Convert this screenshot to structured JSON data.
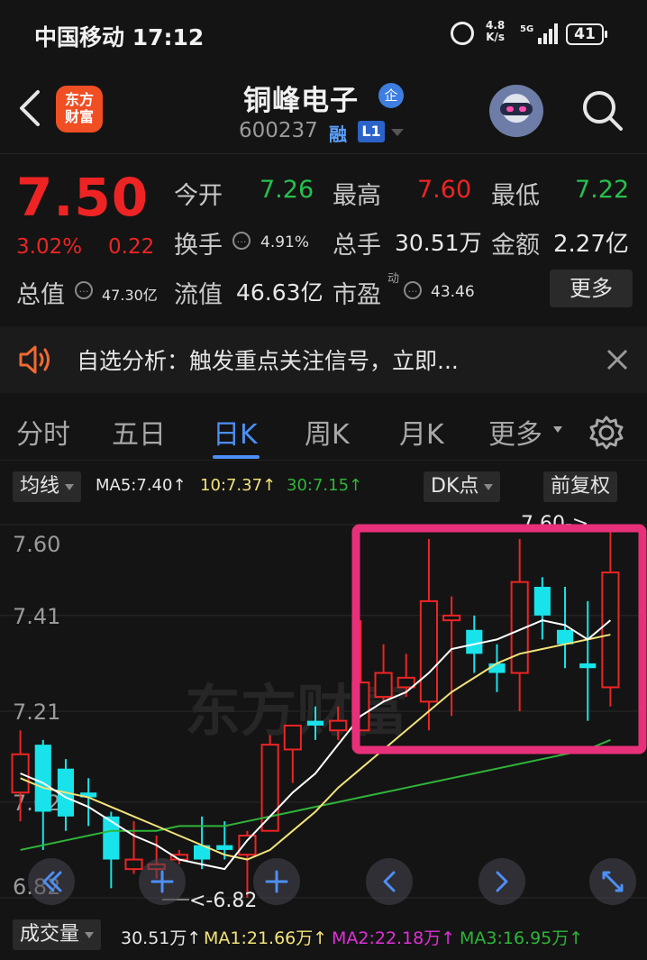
{
  "status": {
    "carrier": "中国移动 17:12",
    "speed_top": "4.8",
    "speed_bottom": "K/s",
    "network": "5G",
    "battery": "41"
  },
  "header": {
    "logo": [
      "东方",
      "财富"
    ],
    "name": "铜峰电子",
    "badge": "企",
    "code": "600237",
    "margin_tag": "融",
    "level": "L1"
  },
  "quote": {
    "price": "7.50",
    "change_pct": "3.02%",
    "change": "0.22",
    "open_label": "今开",
    "open": "7.26",
    "high_label": "最高",
    "high": "7.60",
    "low_label": "最低",
    "low": "7.22",
    "turnover_label": "换手",
    "turnover": "4.91%",
    "volume_label": "总手",
    "volume": "30.51万",
    "amount_label": "金额",
    "amount": "2.27亿",
    "mktcap_label": "总值",
    "mktcap": "47.30亿",
    "float_label": "流值",
    "float": "46.63亿",
    "pe_label": "市盈",
    "pe_sup": "动",
    "pe": "43.46",
    "more": "更多"
  },
  "alert": {
    "text": "自选分析：触发重点关注信号，立即..."
  },
  "tabs": {
    "items": [
      "分时",
      "五日",
      "日K",
      "周K",
      "月K",
      "更多"
    ],
    "active": "日K"
  },
  "ma": {
    "selector": "均线",
    "ma5": "MA5:7.40↑",
    "ma10": "10:7.37↑",
    "ma30": "30:7.15↑",
    "dk": "DK点",
    "adjust": "前复权"
  },
  "colors": {
    "up": "#ee2424",
    "down": "#19e3ea",
    "ma5": "#ffffff",
    "ma10": "#f3e37a",
    "ma30": "#2fb43a",
    "highlight": "#e8307a",
    "accent": "#4d8ff5"
  },
  "chart_data": {
    "type": "candlestick",
    "y_ticks": [
      "7.60",
      "7.41",
      "7.21",
      "7.02",
      "6.82"
    ],
    "ylim": [
      6.82,
      7.6
    ],
    "watermark": "东方财富",
    "high_marker": "7.60->",
    "low_marker": "<-6.82",
    "candles": [
      {
        "o": 7.04,
        "c": 7.12,
        "h": 7.17,
        "l": 6.98
      },
      {
        "o": 7.14,
        "c": 7.0,
        "h": 7.15,
        "l": 6.92
      },
      {
        "o": 7.09,
        "c": 6.99,
        "h": 7.11,
        "l": 6.96
      },
      {
        "o": 7.04,
        "c": 7.03,
        "h": 7.07,
        "l": 6.97
      },
      {
        "o": 6.99,
        "c": 6.9,
        "h": 7.0,
        "l": 6.84
      },
      {
        "o": 6.88,
        "c": 6.9,
        "h": 6.98,
        "l": 6.87
      },
      {
        "o": 6.88,
        "c": 6.89,
        "h": 6.95,
        "l": 6.86
      },
      {
        "o": 6.9,
        "c": 6.91,
        "h": 6.92,
        "l": 6.89
      },
      {
        "o": 6.93,
        "c": 6.9,
        "h": 6.99,
        "l": 6.88
      },
      {
        "o": 6.93,
        "c": 6.92,
        "h": 6.98,
        "l": 6.9
      },
      {
        "o": 6.91,
        "c": 6.95,
        "h": 6.96,
        "l": 6.82
      },
      {
        "o": 6.96,
        "c": 7.14,
        "h": 7.16,
        "l": 6.96
      },
      {
        "o": 7.13,
        "c": 7.18,
        "h": 7.18,
        "l": 7.06
      },
      {
        "o": 7.19,
        "c": 7.18,
        "h": 7.22,
        "l": 7.15
      },
      {
        "o": 7.17,
        "c": 7.19,
        "h": 7.22,
        "l": 7.15
      },
      {
        "o": 7.17,
        "c": 7.27,
        "h": 7.4,
        "l": 7.17
      },
      {
        "o": 7.24,
        "c": 7.29,
        "h": 7.35,
        "l": 7.23
      },
      {
        "o": 7.26,
        "c": 7.28,
        "h": 7.33,
        "l": 7.24
      },
      {
        "o": 7.23,
        "c": 7.44,
        "h": 7.57,
        "l": 7.17
      },
      {
        "o": 7.4,
        "c": 7.41,
        "h": 7.45,
        "l": 7.2
      },
      {
        "o": 7.38,
        "c": 7.33,
        "h": 7.41,
        "l": 7.29
      },
      {
        "o": 7.31,
        "c": 7.29,
        "h": 7.35,
        "l": 7.25
      },
      {
        "o": 7.29,
        "c": 7.48,
        "h": 7.57,
        "l": 7.21
      },
      {
        "o": 7.47,
        "c": 7.41,
        "h": 7.49,
        "l": 7.36
      },
      {
        "o": 7.38,
        "c": 7.35,
        "h": 7.47,
        "l": 7.3
      },
      {
        "o": 7.31,
        "c": 7.3,
        "h": 7.44,
        "l": 7.19
      },
      {
        "o": 7.26,
        "c": 7.5,
        "h": 7.6,
        "l": 7.22
      }
    ],
    "ma5": [
      7.08,
      7.06,
      7.03,
      7.01,
      6.98,
      6.95,
      6.93,
      6.9,
      6.89,
      6.88,
      6.94,
      6.99,
      7.04,
      7.08,
      7.14,
      7.2,
      7.23,
      7.25,
      7.29,
      7.34,
      7.35,
      7.36,
      7.38,
      7.4,
      7.39,
      7.36,
      7.4
    ],
    "ma10": [
      7.07,
      7.05,
      7.04,
      7.03,
      7.01,
      6.99,
      6.97,
      6.95,
      6.93,
      6.91,
      6.9,
      6.92,
      6.96,
      7.0,
      7.05,
      7.09,
      7.13,
      7.17,
      7.21,
      7.25,
      7.28,
      7.31,
      7.33,
      7.34,
      7.35,
      7.36,
      7.37
    ],
    "ma30": [
      6.92,
      6.93,
      6.94,
      6.95,
      6.96,
      6.96,
      6.96,
      6.97,
      6.97,
      6.97,
      6.98,
      6.99,
      7.0,
      7.01,
      7.02,
      7.03,
      7.04,
      7.05,
      7.06,
      7.07,
      7.08,
      7.09,
      7.1,
      7.11,
      7.12,
      7.13,
      7.15
    ]
  },
  "volume": {
    "selector": "成交量",
    "vol": "30.51万↑",
    "ma1": "MA1:21.66万↑",
    "ma2": "MA2:22.18万↑",
    "ma3": "MA3:16.95万↑"
  }
}
